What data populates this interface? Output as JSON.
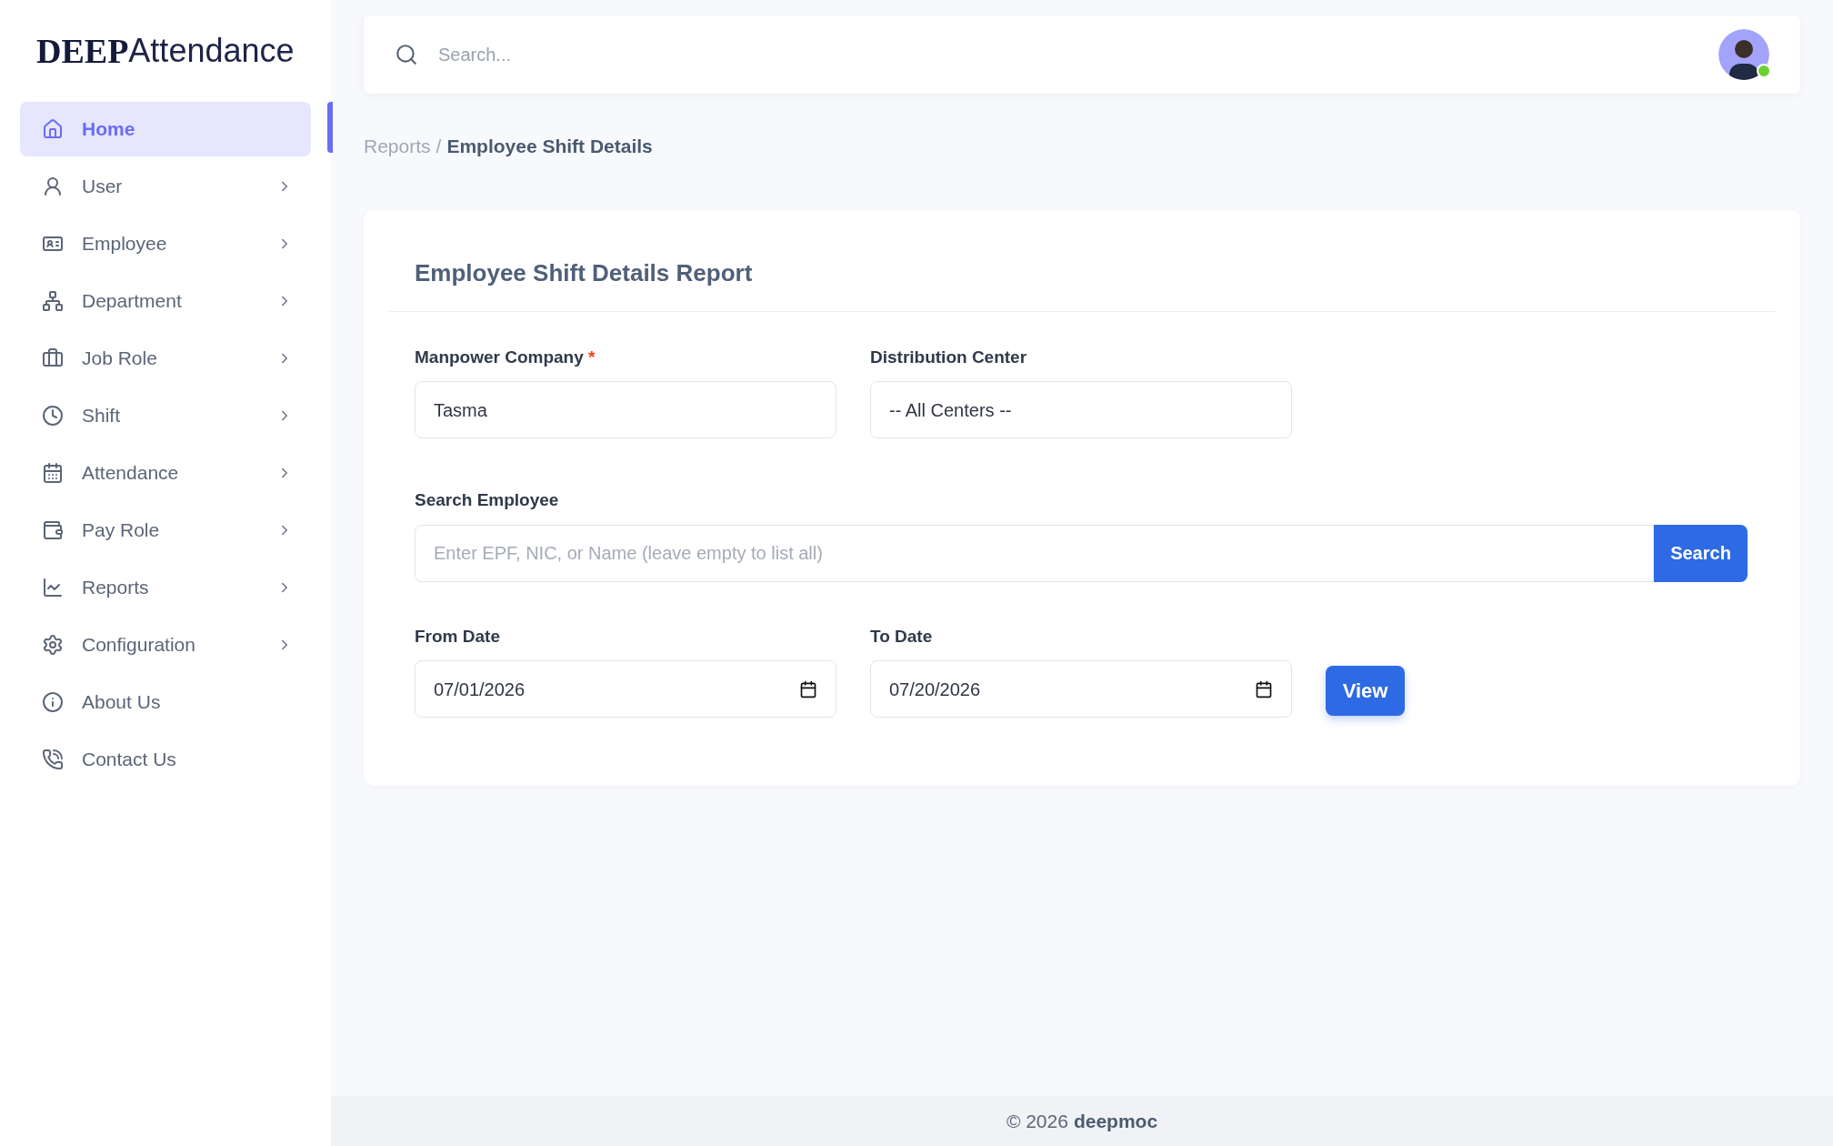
{
  "logo": {
    "part_1": "DEEP",
    "part_2": "Attendance"
  },
  "sidebar": {
    "items": [
      {
        "label": "Home",
        "selected": true,
        "has_submenu": false
      },
      {
        "label": "User",
        "selected": false,
        "has_submenu": true
      },
      {
        "label": "Employee",
        "selected": false,
        "has_submenu": true
      },
      {
        "label": "Department",
        "selected": false,
        "has_submenu": true
      },
      {
        "label": "Job Role",
        "selected": false,
        "has_submenu": true
      },
      {
        "label": "Shift",
        "selected": false,
        "has_submenu": true
      },
      {
        "label": "Attendance",
        "selected": false,
        "has_submenu": true
      },
      {
        "label": "Pay Role",
        "selected": false,
        "has_submenu": true
      },
      {
        "label": "Reports",
        "selected": false,
        "has_submenu": true
      },
      {
        "label": "Configuration",
        "selected": false,
        "has_submenu": true
      },
      {
        "label": "About Us",
        "selected": false,
        "has_submenu": false
      },
      {
        "label": "Contact Us",
        "selected": false,
        "has_submenu": false
      }
    ]
  },
  "header": {
    "search": {
      "placeholder": "Search..."
    },
    "user": {
      "online": true
    }
  },
  "breadcrumb": {
    "parent": "Reports",
    "separator": "/",
    "current": "Employee Shift Details"
  },
  "card": {
    "title": "Employee Shift Details Report",
    "manpower_company": {
      "label": "Manpower Company",
      "required_mark": "*",
      "value": "Tasma"
    },
    "distribution_center": {
      "label": "Distribution Center",
      "value": "-- All Centers --"
    },
    "search_employee": {
      "label": "Search Employee",
      "placeholder": "Enter EPF, NIC, or Name (leave empty to list all)",
      "button": "Search"
    },
    "from_date": {
      "label": "From Date",
      "value": "07/01/2026"
    },
    "to_date": {
      "label": "To Date",
      "value": "07/20/2026"
    },
    "view_button": "View"
  },
  "footer": {
    "copyright": "© 2026",
    "brand": "deepmoc"
  }
}
